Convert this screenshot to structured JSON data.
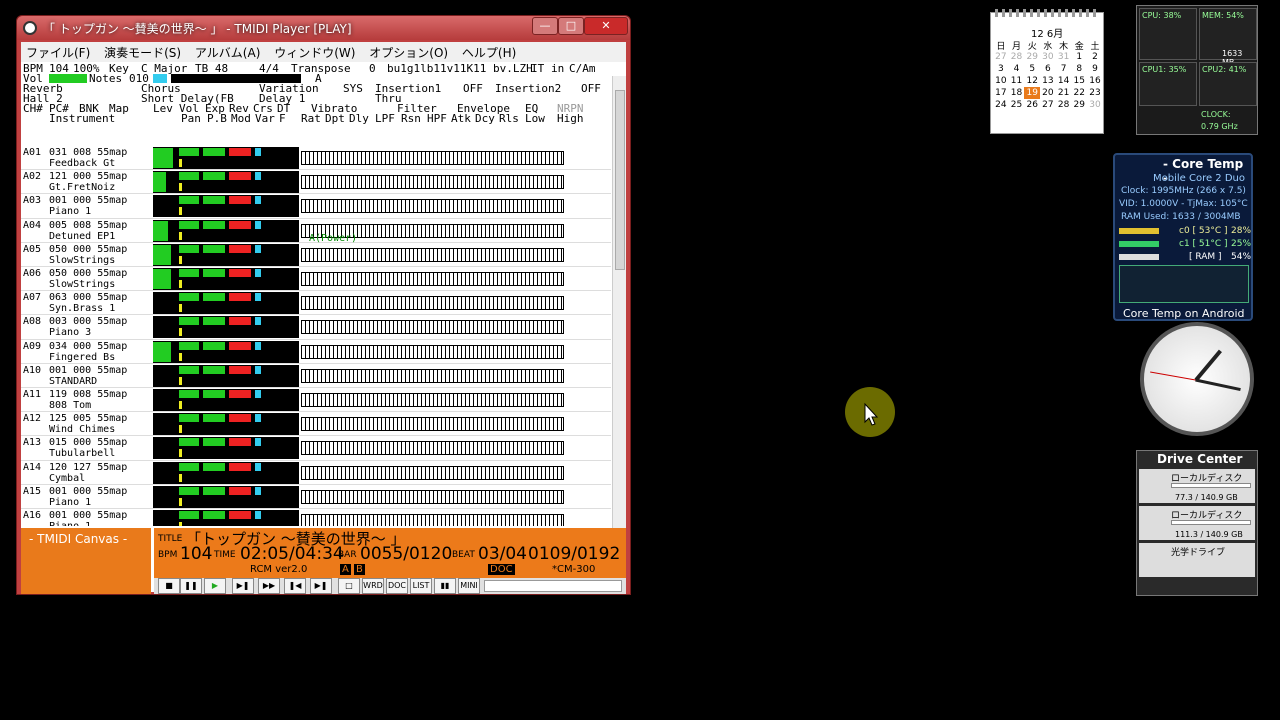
{
  "window": {
    "title": "「 トップガン ～賛美の世界～ 」 - TMIDI Player [PLAY]",
    "min_glyph": "—",
    "max_glyph": "□",
    "close_glyph": "✕"
  },
  "menu": [
    "ファイル(F)",
    "演奏モード(S)",
    "アルバム(A)",
    "ウィンドウ(W)",
    "オプション(O)",
    "ヘルプ(H)"
  ],
  "header": {
    "bpm_label": "BPM",
    "bpm": "104",
    "pct": "100%",
    "key_label": "Key",
    "key": "C Major",
    "tb": "TB 48",
    "sig": "4/4",
    "transpose_label": "Transpose",
    "transpose": "0",
    "file": "bu1g1lb11v11K11 bv.LZH",
    "it": "IT",
    "in": "in",
    "cam": "C/Am",
    "vol_label": "Vol",
    "notes_label": "Notes",
    "notes": "010",
    "marker": "A",
    "reverb_label": "Reverb",
    "reverb": "Hall 2",
    "chorus_label": "Chorus",
    "chorus": "Short Delay(FB",
    "variation_label": "Variation",
    "variation": "Delay 1",
    "sys_label": "SYS",
    "thru": "Thru",
    "insertion1_label": "Insertion1",
    "insertion1": "OFF",
    "insertion2_label": "Insertion2",
    "insertion2": "OFF",
    "col_ch": "CH#",
    "col_pc": "PC#",
    "col_bnk": "BNK",
    "col_map": "Map",
    "col_instrument": "Instrument",
    "col_lev": "Lev",
    "col_vol": "Vol",
    "col_exp": "Exp",
    "col_rev": "Rev",
    "col_crs": "Crs",
    "col_dt": "DT",
    "col_pan": "Pan",
    "col_pb": "P.B",
    "col_mod": "Mod",
    "col_var": "Var",
    "col_f": "F",
    "col_vibrato": "Vibrato",
    "col_filter": "Filter",
    "col_envelope": "Envelope",
    "col_eq": "EQ",
    "col_nrpn": "NRPN",
    "col_rat": "Rat",
    "col_dpt": "Dpt",
    "col_dly": "Dly",
    "col_lpf": "LPF",
    "col_rsn": "Rsn",
    "col_hpf": "HPF",
    "col_atk": "Atk",
    "col_dcy": "Dcy",
    "col_rls": "Rls",
    "col_low": "Low",
    "col_high": "High"
  },
  "channels": [
    {
      "ch": "A01",
      "pc": "031",
      "bnk": "008",
      "map": "55map",
      "instrument": "Feedback Gt",
      "lev": 0.9
    },
    {
      "ch": "A02",
      "pc": "121",
      "bnk": "000",
      "map": "55map",
      "instrument": "Gt.FretNoiz",
      "lev": 0.6
    },
    {
      "ch": "A03",
      "pc": "001",
      "bnk": "000",
      "map": "55map",
      "instrument": "Piano 1",
      "lev": 0.0
    },
    {
      "ch": "A04",
      "pc": "005",
      "bnk": "008",
      "map": "55map",
      "instrument": "Detuned EP1",
      "lev": 0.7,
      "note": "A(Power)"
    },
    {
      "ch": "A05",
      "pc": "050",
      "bnk": "000",
      "map": "55map",
      "instrument": "SlowStrings",
      "lev": 0.8
    },
    {
      "ch": "A06",
      "pc": "050",
      "bnk": "000",
      "map": "55map",
      "instrument": "SlowStrings",
      "lev": 0.8
    },
    {
      "ch": "A07",
      "pc": "063",
      "bnk": "000",
      "map": "55map",
      "instrument": "Syn.Brass 1",
      "lev": 0.0
    },
    {
      "ch": "A08",
      "pc": "003",
      "bnk": "000",
      "map": "55map",
      "instrument": "Piano 3",
      "lev": 0.0
    },
    {
      "ch": "A09",
      "pc": "034",
      "bnk": "000",
      "map": "55map",
      "instrument": "Fingered Bs",
      "lev": 0.8
    },
    {
      "ch": "A10",
      "pc": "001",
      "bnk": "000",
      "map": "55map",
      "instrument": "STANDARD",
      "lev": 0.0
    },
    {
      "ch": "A11",
      "pc": "119",
      "bnk": "008",
      "map": "55map",
      "instrument": "808 Tom",
      "lev": 0.0
    },
    {
      "ch": "A12",
      "pc": "125",
      "bnk": "005",
      "map": "55map",
      "instrument": "Wind Chimes",
      "lev": 0.0
    },
    {
      "ch": "A13",
      "pc": "015",
      "bnk": "000",
      "map": "55map",
      "instrument": "Tubularbell",
      "lev": 0.0
    },
    {
      "ch": "A14",
      "pc": "120",
      "bnk": "127",
      "map": "55map",
      "instrument": "Cymbal",
      "lev": 0.0
    },
    {
      "ch": "A15",
      "pc": "001",
      "bnk": "000",
      "map": "55map",
      "instrument": "Piano 1",
      "lev": 0.0
    },
    {
      "ch": "A16",
      "pc": "001",
      "bnk": "000",
      "map": "55map",
      "instrument": "Piano 1",
      "lev": 0.0
    }
  ],
  "canvas": {
    "title": "- TMIDI Canvas -"
  },
  "status": {
    "title_label": "TITLE",
    "title": "「トップガン ～賛美の世界～ 」",
    "bpm_label": "BPM",
    "bpm": "104",
    "time_label": "TIME",
    "time": "02:05/04:34",
    "bar_label": "BAR",
    "bar": "0055/0120",
    "beat_label": "BEAT",
    "beat": "03/04",
    "tick": "0109/0192",
    "rcm": "RCM ver2.0",
    "doc": "DOC",
    "cm": "*CM-300",
    "a": "A",
    "b": "B"
  },
  "controls": [
    "■",
    "❚❚",
    "▶",
    "▶❚",
    "▶▶",
    "❚◀",
    "▶❚",
    "□",
    "WRD",
    "DOC",
    "LIST",
    "▮▮",
    "MINI"
  ],
  "calendar": {
    "month": "12 6月",
    "days": [
      "日",
      "月",
      "火",
      "水",
      "木",
      "金",
      "土"
    ],
    "grid": [
      "27",
      "28",
      "29",
      "30",
      "31",
      "1",
      "2",
      "3",
      "4",
      "5",
      "6",
      "7",
      "8",
      "9",
      "10",
      "11",
      "12",
      "13",
      "14",
      "15",
      "16",
      "17",
      "18",
      "19",
      "20",
      "21",
      "22",
      "23",
      "24",
      "25",
      "26",
      "27",
      "28",
      "29",
      "30"
    ],
    "today": "19"
  },
  "cpu": {
    "cpu": "CPU: 38%",
    "mem": "MEM: 54%",
    "mem_size": "1633 MB",
    "cpu1": "CPU1: 35%",
    "cpu2": "CPU2: 41%",
    "clock_label": "CLOCK:",
    "clock": "0.79 GHz"
  },
  "coretemp": {
    "title": "- Core Temp -",
    "model": "Mobile Core 2 Duo",
    "clock": "Clock: 1995MHz (266 x 7.5)",
    "vid": "VID: 1.0000V - TjMax: 105°C",
    "ram": "RAM Used: 1633 / 3004MB",
    "c0": "c0 [ 53°C ]",
    "c0_pct": "28%",
    "c1": "c1 [ 51°C ]",
    "c1_pct": "25%",
    "ram_label": "[ RAM ]",
    "ram_pct": "54%",
    "footer": "Core Temp on Android"
  },
  "drive": {
    "title": "Drive Center",
    "d1_name": "ローカルディスク",
    "d1_size": "77.3 / 140.9 GB",
    "d2_name": "ローカルディスク",
    "d2_size": "111.3 / 140.9 GB",
    "d3_name": "光学ドライブ"
  },
  "colors": {
    "accent_orange": "#ec7a1a",
    "window_red": "#c04040",
    "meter_green": "#22cc22"
  }
}
